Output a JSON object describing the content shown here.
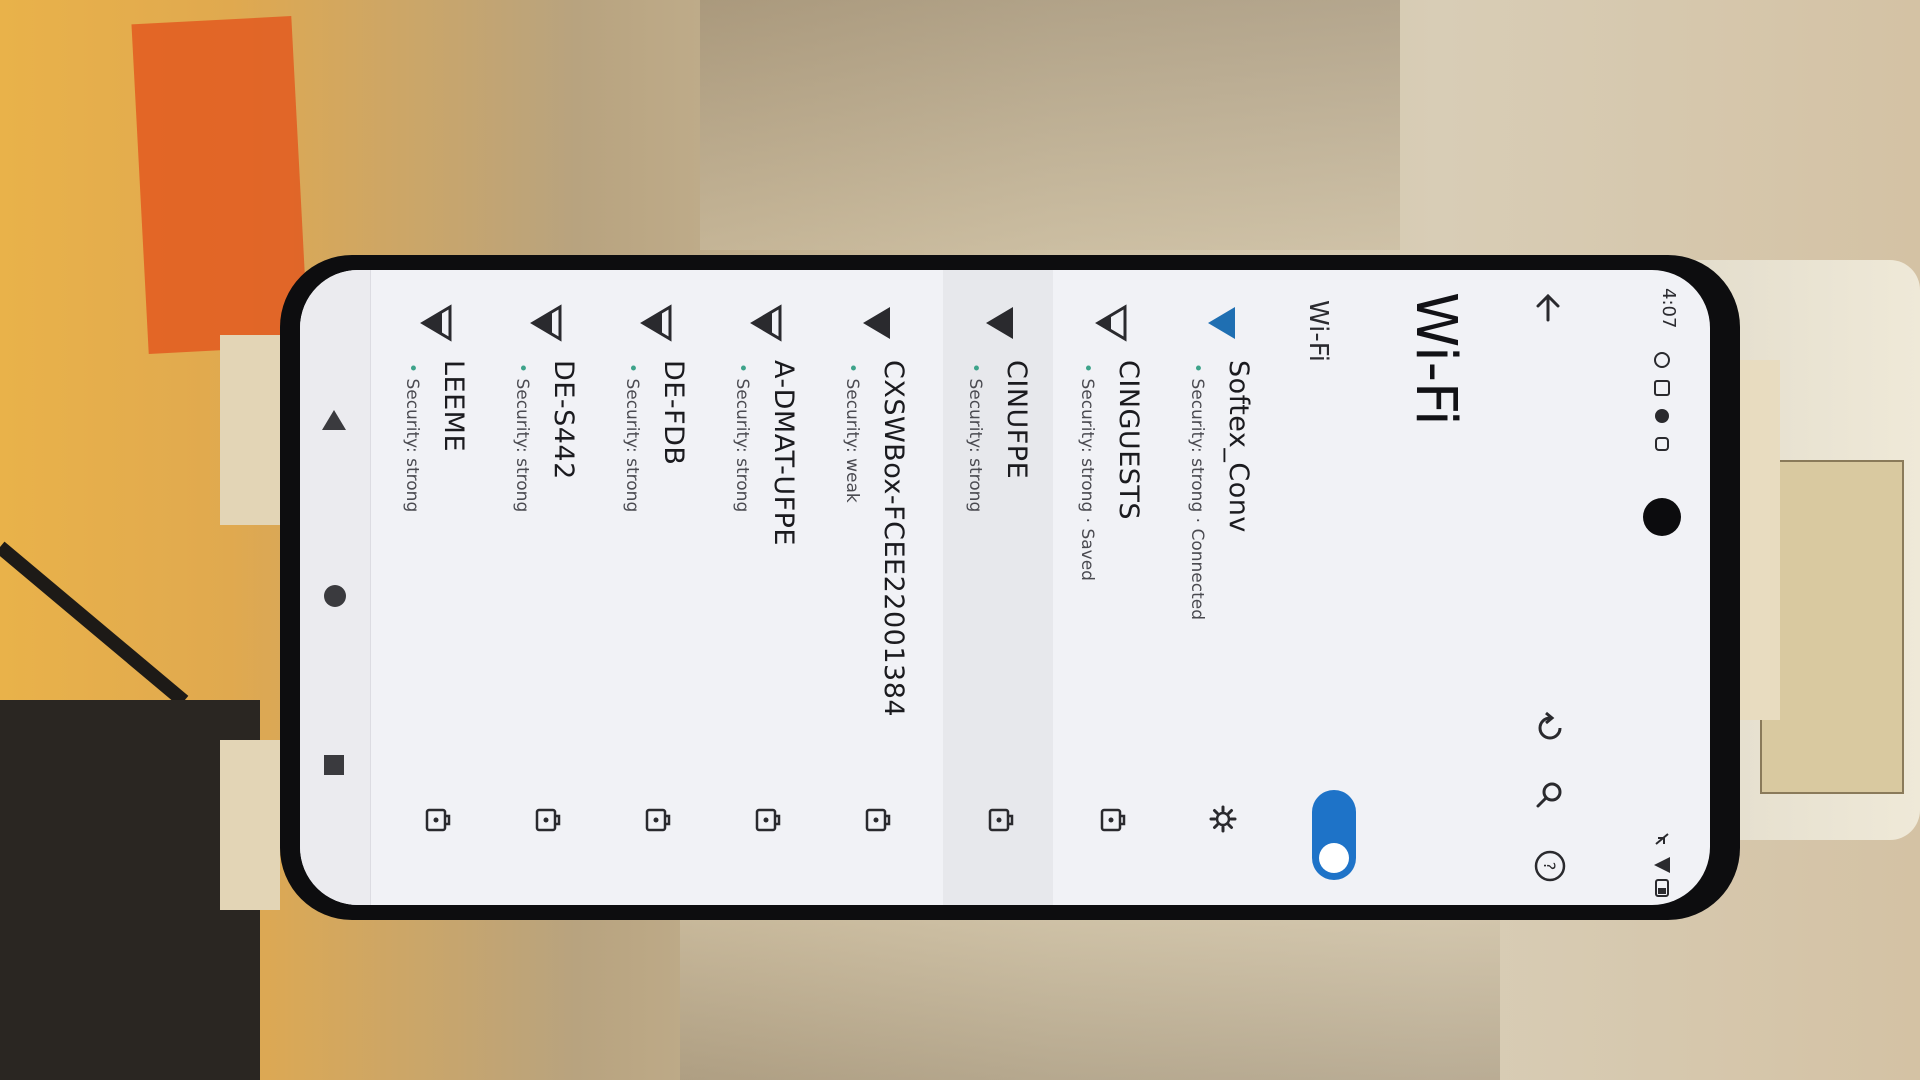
{
  "status_bar": {
    "time": "4:07"
  },
  "app_bar": {
    "back_icon": "arrow-back-icon",
    "refresh_icon": "refresh-icon",
    "search_icon": "search-icon",
    "help_icon": "help-icon"
  },
  "header": {
    "title": "Wi-Fi",
    "toggle_label": "Wi-Fi",
    "toggle_on": true
  },
  "networks": [
    {
      "name": "Softex_Conv",
      "subtitle": "Security: strong · Connected",
      "connected": true,
      "action_icon": "gear-icon"
    },
    {
      "name": "CINGUESTS",
      "subtitle": "Security: strong · Saved",
      "connected": false,
      "action_icon": "lock-icon"
    },
    {
      "name": "CINUFPE",
      "subtitle": "Security: strong",
      "connected": false,
      "action_icon": "lock-icon"
    },
    {
      "name": "CXSWBox-FCEE22001384",
      "subtitle": "Security: weak",
      "connected": false,
      "action_icon": "lock-icon"
    },
    {
      "name": "A-DMAT-UFPE",
      "subtitle": "Security: strong",
      "connected": false,
      "action_icon": "lock-icon"
    },
    {
      "name": "DE-FDB",
      "subtitle": "Security: strong",
      "connected": false,
      "action_icon": "lock-icon"
    },
    {
      "name": "DE-S442",
      "subtitle": "Security: strong",
      "connected": false,
      "action_icon": "lock-icon"
    },
    {
      "name": "LEEME",
      "subtitle": "Security: strong",
      "connected": false,
      "action_icon": "lock-icon"
    }
  ],
  "colors": {
    "accent": "#1e73c8",
    "connected_wifi": "#1f6fb2",
    "security_dot": "#3da38a"
  }
}
